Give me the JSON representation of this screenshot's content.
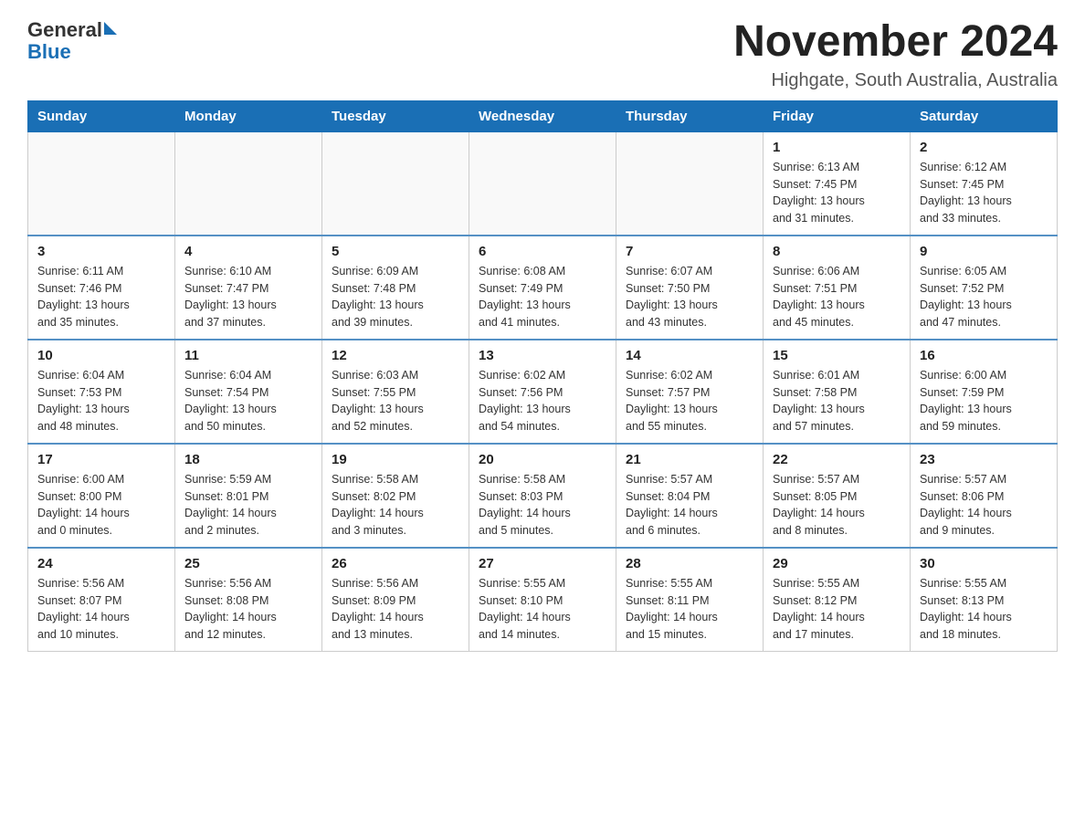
{
  "logo": {
    "general": "General",
    "blue": "Blue"
  },
  "title": "November 2024",
  "subtitle": "Highgate, South Australia, Australia",
  "days_of_week": [
    "Sunday",
    "Monday",
    "Tuesday",
    "Wednesday",
    "Thursday",
    "Friday",
    "Saturday"
  ],
  "weeks": [
    [
      {
        "day": "",
        "info": ""
      },
      {
        "day": "",
        "info": ""
      },
      {
        "day": "",
        "info": ""
      },
      {
        "day": "",
        "info": ""
      },
      {
        "day": "",
        "info": ""
      },
      {
        "day": "1",
        "info": "Sunrise: 6:13 AM\nSunset: 7:45 PM\nDaylight: 13 hours\nand 31 minutes."
      },
      {
        "day": "2",
        "info": "Sunrise: 6:12 AM\nSunset: 7:45 PM\nDaylight: 13 hours\nand 33 minutes."
      }
    ],
    [
      {
        "day": "3",
        "info": "Sunrise: 6:11 AM\nSunset: 7:46 PM\nDaylight: 13 hours\nand 35 minutes."
      },
      {
        "day": "4",
        "info": "Sunrise: 6:10 AM\nSunset: 7:47 PM\nDaylight: 13 hours\nand 37 minutes."
      },
      {
        "day": "5",
        "info": "Sunrise: 6:09 AM\nSunset: 7:48 PM\nDaylight: 13 hours\nand 39 minutes."
      },
      {
        "day": "6",
        "info": "Sunrise: 6:08 AM\nSunset: 7:49 PM\nDaylight: 13 hours\nand 41 minutes."
      },
      {
        "day": "7",
        "info": "Sunrise: 6:07 AM\nSunset: 7:50 PM\nDaylight: 13 hours\nand 43 minutes."
      },
      {
        "day": "8",
        "info": "Sunrise: 6:06 AM\nSunset: 7:51 PM\nDaylight: 13 hours\nand 45 minutes."
      },
      {
        "day": "9",
        "info": "Sunrise: 6:05 AM\nSunset: 7:52 PM\nDaylight: 13 hours\nand 47 minutes."
      }
    ],
    [
      {
        "day": "10",
        "info": "Sunrise: 6:04 AM\nSunset: 7:53 PM\nDaylight: 13 hours\nand 48 minutes."
      },
      {
        "day": "11",
        "info": "Sunrise: 6:04 AM\nSunset: 7:54 PM\nDaylight: 13 hours\nand 50 minutes."
      },
      {
        "day": "12",
        "info": "Sunrise: 6:03 AM\nSunset: 7:55 PM\nDaylight: 13 hours\nand 52 minutes."
      },
      {
        "day": "13",
        "info": "Sunrise: 6:02 AM\nSunset: 7:56 PM\nDaylight: 13 hours\nand 54 minutes."
      },
      {
        "day": "14",
        "info": "Sunrise: 6:02 AM\nSunset: 7:57 PM\nDaylight: 13 hours\nand 55 minutes."
      },
      {
        "day": "15",
        "info": "Sunrise: 6:01 AM\nSunset: 7:58 PM\nDaylight: 13 hours\nand 57 minutes."
      },
      {
        "day": "16",
        "info": "Sunrise: 6:00 AM\nSunset: 7:59 PM\nDaylight: 13 hours\nand 59 minutes."
      }
    ],
    [
      {
        "day": "17",
        "info": "Sunrise: 6:00 AM\nSunset: 8:00 PM\nDaylight: 14 hours\nand 0 minutes."
      },
      {
        "day": "18",
        "info": "Sunrise: 5:59 AM\nSunset: 8:01 PM\nDaylight: 14 hours\nand 2 minutes."
      },
      {
        "day": "19",
        "info": "Sunrise: 5:58 AM\nSunset: 8:02 PM\nDaylight: 14 hours\nand 3 minutes."
      },
      {
        "day": "20",
        "info": "Sunrise: 5:58 AM\nSunset: 8:03 PM\nDaylight: 14 hours\nand 5 minutes."
      },
      {
        "day": "21",
        "info": "Sunrise: 5:57 AM\nSunset: 8:04 PM\nDaylight: 14 hours\nand 6 minutes."
      },
      {
        "day": "22",
        "info": "Sunrise: 5:57 AM\nSunset: 8:05 PM\nDaylight: 14 hours\nand 8 minutes."
      },
      {
        "day": "23",
        "info": "Sunrise: 5:57 AM\nSunset: 8:06 PM\nDaylight: 14 hours\nand 9 minutes."
      }
    ],
    [
      {
        "day": "24",
        "info": "Sunrise: 5:56 AM\nSunset: 8:07 PM\nDaylight: 14 hours\nand 10 minutes."
      },
      {
        "day": "25",
        "info": "Sunrise: 5:56 AM\nSunset: 8:08 PM\nDaylight: 14 hours\nand 12 minutes."
      },
      {
        "day": "26",
        "info": "Sunrise: 5:56 AM\nSunset: 8:09 PM\nDaylight: 14 hours\nand 13 minutes."
      },
      {
        "day": "27",
        "info": "Sunrise: 5:55 AM\nSunset: 8:10 PM\nDaylight: 14 hours\nand 14 minutes."
      },
      {
        "day": "28",
        "info": "Sunrise: 5:55 AM\nSunset: 8:11 PM\nDaylight: 14 hours\nand 15 minutes."
      },
      {
        "day": "29",
        "info": "Sunrise: 5:55 AM\nSunset: 8:12 PM\nDaylight: 14 hours\nand 17 minutes."
      },
      {
        "day": "30",
        "info": "Sunrise: 5:55 AM\nSunset: 8:13 PM\nDaylight: 14 hours\nand 18 minutes."
      }
    ]
  ]
}
